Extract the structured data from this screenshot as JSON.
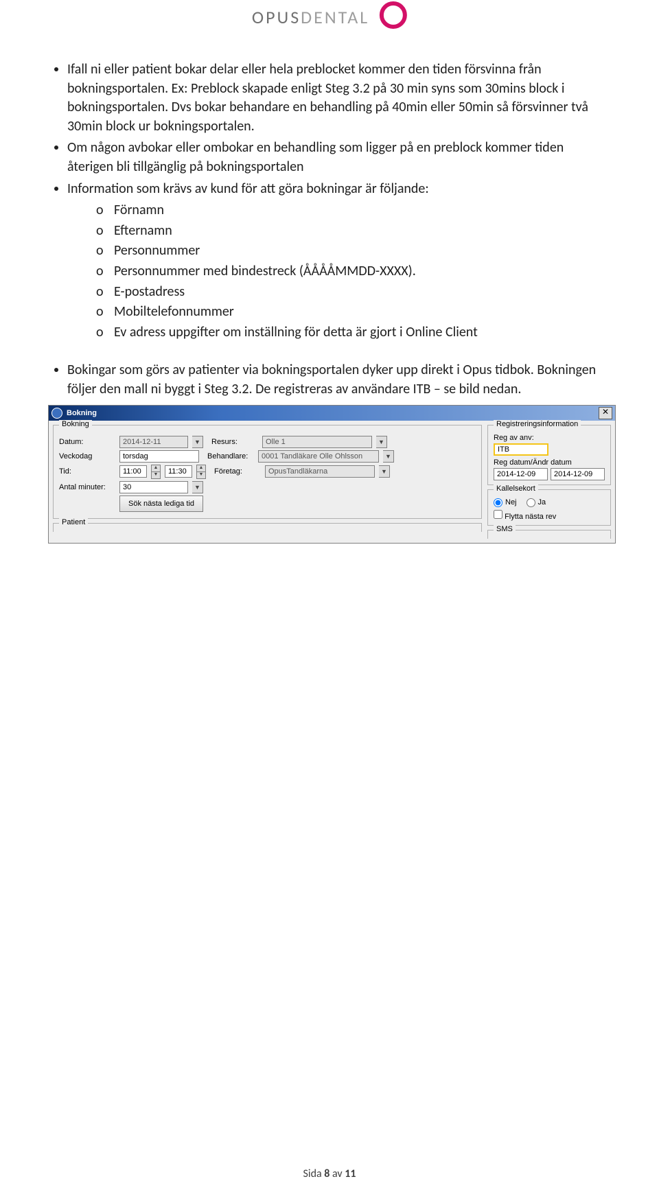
{
  "logo": {
    "brand1": "OPUS",
    "brand2": "DENTAL"
  },
  "bullets": {
    "b1": "Ifall ni eller patient bokar delar eller hela preblocket kommer den tiden försvinna från bokningsportalen. Ex: Preblock skapade enligt Steg 3.2 på 30 min syns som 30mins block i bokningsportalen. Dvs bokar behandare en behandling på 40min eller 50min så försvinner två 30min block ur bokningsportalen.",
    "b2": "Om någon avbokar eller ombokar en behandling som ligger på en preblock kommer tiden återigen bli tillgänglig på bokningsportalen",
    "b3": "Information som krävs av kund för att göra bokningar är följande:",
    "sub": {
      "s1": "Förnamn",
      "s2": "Efternamn",
      "s3": "Personnummer",
      "s4": "Personnummer med bindestreck (ÅÅÅÅMMDD-XXXX).",
      "s5": "E-postadress",
      "s6": "Mobiltelefonnummer",
      "s7": "Ev adress uppgifter om inställning för detta är gjort i Online Client"
    },
    "b4": "Bokingar som görs av patienter via bokningsportalen dyker upp direkt i Opus tidbok. Bokningen följer den mall ni byggt i Steg 3.2. De registreras av användare ITB – se bild nedan."
  },
  "dialog": {
    "title": "Bokning",
    "grp_bokning": "Bokning",
    "grp_patient": "Patient",
    "lbl_datum": "Datum:",
    "val_datum": "2014-12-11",
    "lbl_veckodag": "Veckodag",
    "val_veckodag": "torsdag",
    "lbl_tid": "Tid:",
    "val_tid_from": "11:00",
    "val_tid_to": "11:30",
    "lbl_antal": "Antal minuter:",
    "val_antal": "30",
    "btn_sok": "Sök nästa lediga tid",
    "lbl_resurs": "Resurs:",
    "val_resurs": "Olle 1",
    "lbl_behandlare": "Behandlare:",
    "val_behandlare": "0001 Tandläkare Olle Ohlsson",
    "lbl_foretag": "Företag:",
    "val_foretag": "OpusTandläkarna",
    "grp_reginfo": "Registreringsinformation",
    "lbl_regav": "Reg av anv:",
    "val_regav": "ITB",
    "lbl_regdatum": "Reg datum/Ändr datum",
    "val_regdatum1": "2014-12-09",
    "val_regdatum2": "2014-12-09",
    "grp_kallelse": "Kallelsekort",
    "opt_nej": "Nej",
    "opt_ja": "Ja",
    "chk_flytta": "Flytta nästa rev",
    "grp_sms": "SMS"
  },
  "footer": {
    "prefix": "Sida ",
    "page": "8",
    "mid": " av ",
    "total": "11"
  }
}
